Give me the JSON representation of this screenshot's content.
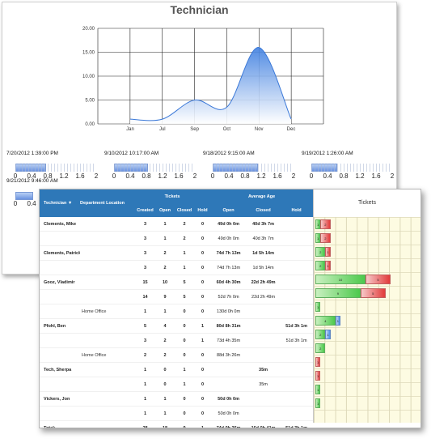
{
  "chart_data": {
    "type": "area",
    "title": "Technician",
    "categories": [
      "Jan",
      "Jul",
      "Sep",
      "Oct",
      "Nov",
      "Dec"
    ],
    "y_ticks": [
      "20.00",
      "15.00",
      "10.00",
      "5.00",
      "0.00"
    ],
    "ylim": [
      0,
      20
    ],
    "series": [
      {
        "values": [
          1,
          1,
          5,
          3.5,
          16,
          1
        ]
      }
    ],
    "grid": true
  },
  "timelines": [
    {
      "timestamp": "7/20/2012 1:39:00 PM",
      "fill": 0.38
    },
    {
      "timestamp": "9/10/2012 10:17:00 AM",
      "fill": 0.42
    },
    {
      "timestamp": "9/18/2012 9:15:00 AM",
      "fill": 0.56
    },
    {
      "timestamp": "9/19/2012 1:26:00 AM",
      "fill": 0.32
    },
    {
      "timestamp": "9/21/2012 9:46:00 AM",
      "fill": 0.3
    }
  ],
  "scale_labels": [
    "0",
    "0.4",
    "0.8",
    "1.2",
    "1.6",
    "2"
  ],
  "grid": {
    "headers": {
      "technician": "Technician",
      "technician_sort": "▼",
      "department": "Department Location",
      "tickets": "Tickets",
      "average_age": "Average Age",
      "created": "Created",
      "open": "Open",
      "closed": "Closed",
      "hold": "Hold",
      "open_age": "Open",
      "closed_age": "Closed",
      "hold_age": "Hold",
      "bars_title": "Tickets"
    },
    "rows": [
      {
        "tech": "Clements, Mike",
        "loc": "",
        "created": "3",
        "open": "1",
        "closed": "2",
        "hold": "0",
        "open_age": "49d 0h 0m",
        "closed_age": "40d 3h 7m",
        "hold_age": "",
        "bold": true,
        "bars": [
          1,
          2,
          0
        ]
      },
      {
        "tech": "",
        "loc": "",
        "created": "3",
        "open": "1",
        "closed": "2",
        "hold": "0",
        "open_age": "49d 0h 0m",
        "closed_age": "40d 3h 7m",
        "hold_age": "",
        "bold": false,
        "bars": [
          1,
          2,
          0
        ]
      },
      {
        "tech": "Clements, Patrick",
        "loc": "",
        "created": "3",
        "open": "2",
        "closed": "1",
        "hold": "0",
        "open_age": "74d 7h 13m",
        "closed_age": "1d 5h 14m",
        "hold_age": "",
        "bold": true,
        "bars": [
          2,
          1,
          0
        ]
      },
      {
        "tech": "",
        "loc": "",
        "created": "3",
        "open": "2",
        "closed": "1",
        "hold": "0",
        "open_age": "74d 7h 13m",
        "closed_age": "1d 5h 14m",
        "hold_age": "",
        "bold": false,
        "bars": [
          2,
          1,
          0
        ]
      },
      {
        "tech": "Gooz, Vladimir",
        "loc": "",
        "created": "15",
        "open": "10",
        "closed": "5",
        "hold": "0",
        "open_age": "60d 4h 30m",
        "closed_age": "22d 2h 49m",
        "hold_age": "",
        "bold": true,
        "bars": [
          10,
          5,
          0
        ]
      },
      {
        "tech": "",
        "loc": "",
        "created": "14",
        "open": "9",
        "closed": "5",
        "hold": "0",
        "open_age": "52d 7h 0m",
        "closed_age": "22d 2h 49m",
        "hold_age": "",
        "bold": false,
        "bars": [
          9,
          5,
          0
        ]
      },
      {
        "tech": "",
        "loc": "Home Office",
        "created": "1",
        "open": "1",
        "closed": "0",
        "hold": "0",
        "open_age": "130d 0h 0m",
        "closed_age": "",
        "hold_age": "",
        "bold": false,
        "bars": [
          1,
          0,
          0
        ]
      },
      {
        "tech": "Pfohl, Ben",
        "loc": "",
        "created": "5",
        "open": "4",
        "closed": "0",
        "hold": "1",
        "open_age": "80d 8h 31m",
        "closed_age": "",
        "hold_age": "51d 3h 1m",
        "bold": true,
        "bars": [
          4,
          0,
          1
        ]
      },
      {
        "tech": "",
        "loc": "",
        "created": "3",
        "open": "2",
        "closed": "0",
        "hold": "1",
        "open_age": "73d 4h 35m",
        "closed_age": "",
        "hold_age": "51d 3h 1m",
        "bold": false,
        "bars": [
          2,
          0,
          1
        ]
      },
      {
        "tech": "",
        "loc": "Home Office",
        "created": "2",
        "open": "2",
        "closed": "0",
        "hold": "0",
        "open_age": "88d 3h 26m",
        "closed_age": "",
        "hold_age": "",
        "bold": false,
        "bars": [
          2,
          0,
          0
        ]
      },
      {
        "tech": "Tech, Sherpa",
        "loc": "",
        "created": "1",
        "open": "0",
        "closed": "1",
        "hold": "0",
        "open_age": "",
        "closed_age": "35m",
        "hold_age": "",
        "bold": true,
        "bars": [
          0,
          1,
          0
        ]
      },
      {
        "tech": "",
        "loc": "",
        "created": "1",
        "open": "0",
        "closed": "1",
        "hold": "0",
        "open_age": "",
        "closed_age": "35m",
        "hold_age": "",
        "bold": false,
        "bars": [
          0,
          1,
          0
        ]
      },
      {
        "tech": "Vickers, Jon",
        "loc": "",
        "created": "1",
        "open": "1",
        "closed": "0",
        "hold": "0",
        "open_age": "50d 0h 0m",
        "closed_age": "",
        "hold_age": "",
        "bold": true,
        "bars": [
          1,
          0,
          0
        ]
      },
      {
        "tech": "",
        "loc": "",
        "created": "1",
        "open": "1",
        "closed": "0",
        "hold": "0",
        "open_age": "50d 0h 0m",
        "closed_age": "",
        "hold_age": "",
        "bold": false,
        "bars": [
          1,
          0,
          0
        ]
      },
      {
        "tech": "Total:",
        "loc": "",
        "created": "28",
        "open": "18",
        "closed": "9",
        "hold": "1",
        "open_age": "74d 0h 36m",
        "closed_age": "16d 0h 41m",
        "hold_age": "51d 3h 1m",
        "bold": true,
        "bars": []
      }
    ]
  },
  "colors": {
    "header_blue": "#2e78b8",
    "open_green": "#4cc94c",
    "closed_red": "#e23b3b",
    "hold_blue": "#4e8fe6",
    "bar_bg": "#fdfbe2"
  }
}
